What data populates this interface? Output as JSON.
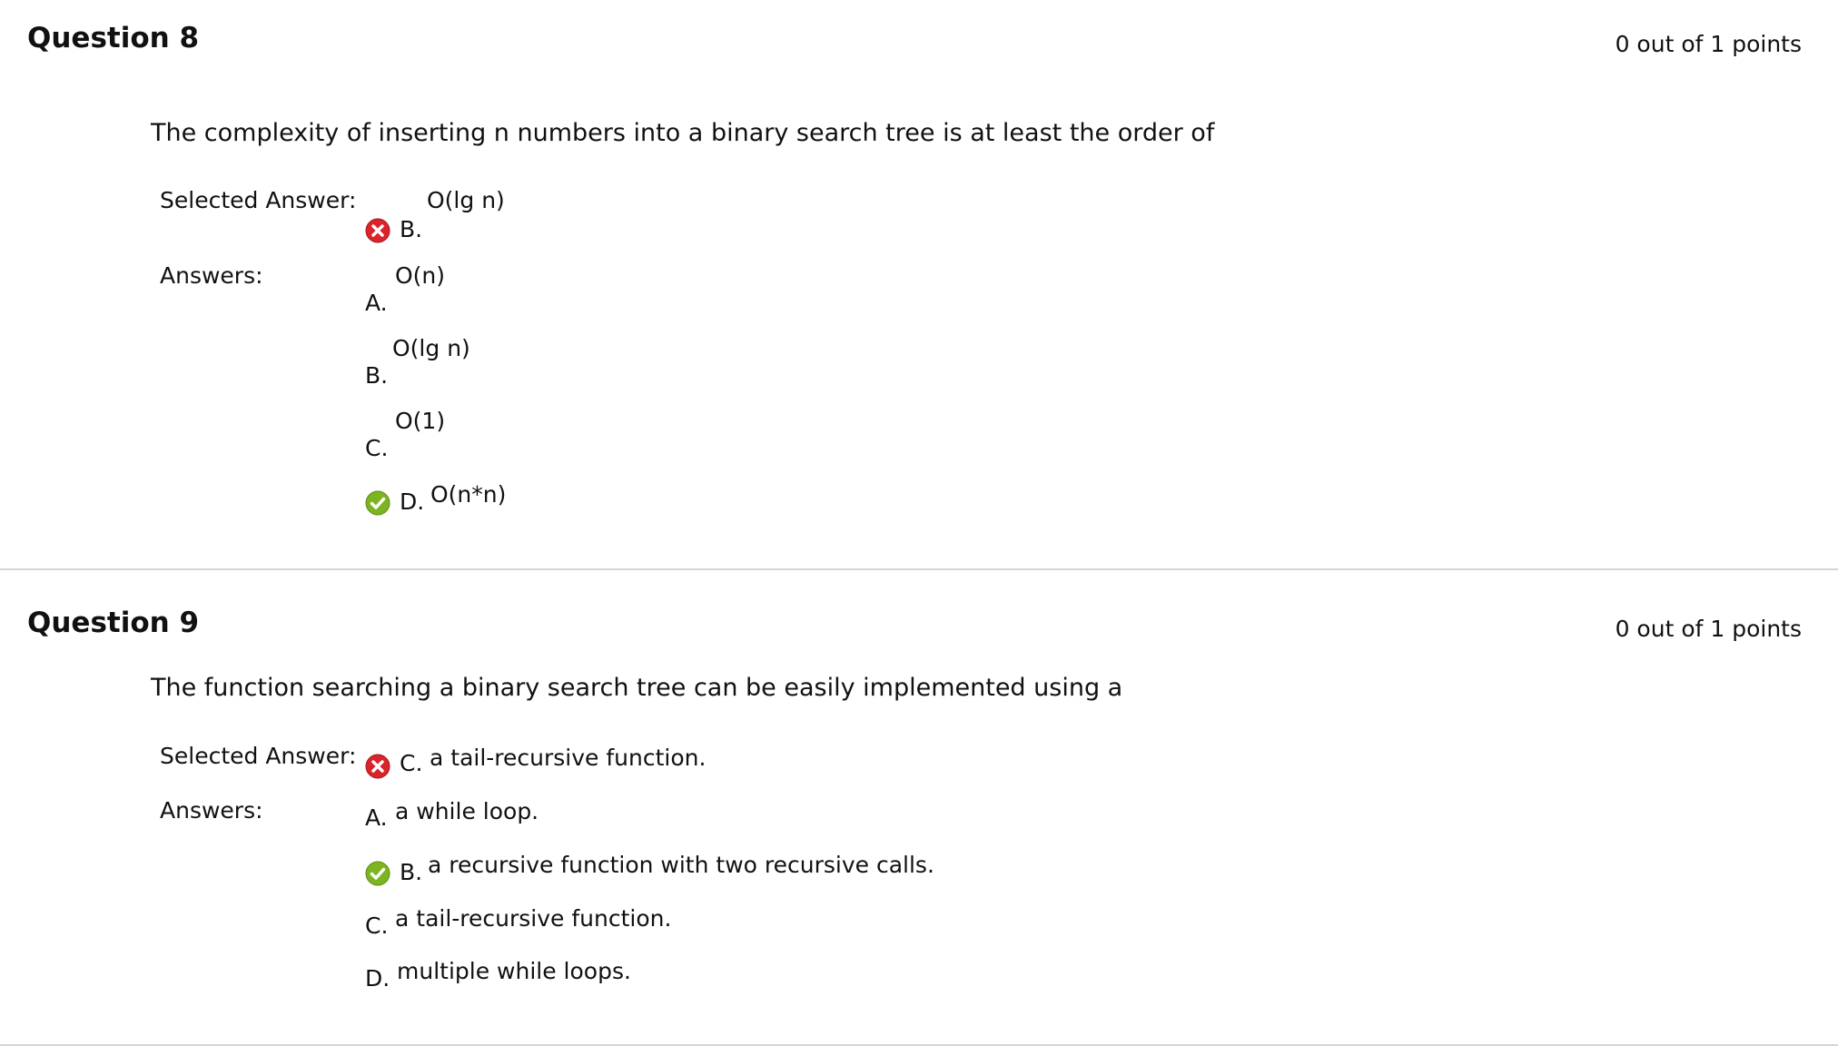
{
  "questions": [
    {
      "title": "Question 8",
      "points": "0 out of 1 points",
      "text": "The complexity of inserting n numbers into a binary search tree is at least the order of",
      "selected_label": "Selected Answer:",
      "answers_label": "Answers:",
      "selected": {
        "letter": "B.",
        "text": "O(lg n)",
        "status": "incorrect"
      },
      "answers": [
        {
          "letter": "A.",
          "text": "O(n)"
        },
        {
          "letter": "B.",
          "text": "O(lg n)"
        },
        {
          "letter": "C.",
          "text": "O(1)"
        },
        {
          "letter": "D.",
          "text": "O(n*n)",
          "status": "correct"
        }
      ]
    },
    {
      "title": "Question 9",
      "points": "0 out of 1 points",
      "text": "The function searching a binary search tree can be easily implemented using a",
      "selected_label": "Selected Answer:",
      "answers_label": "Answers:",
      "selected": {
        "letter": "C.",
        "text": "a tail-recursive function.",
        "status": "incorrect"
      },
      "answers": [
        {
          "letter": "A.",
          "text": "a while loop."
        },
        {
          "letter": "B.",
          "text": "a recursive function with two recursive calls.",
          "status": "correct"
        },
        {
          "letter": "C.",
          "text": "a tail-recursive function."
        },
        {
          "letter": "D.",
          "text": "multiple while loops."
        }
      ]
    }
  ],
  "icons": {
    "incorrect": {
      "name": "incorrect-x-icon",
      "color": "#d9242b"
    },
    "correct": {
      "name": "correct-check-icon",
      "color": "#7cb521"
    }
  }
}
